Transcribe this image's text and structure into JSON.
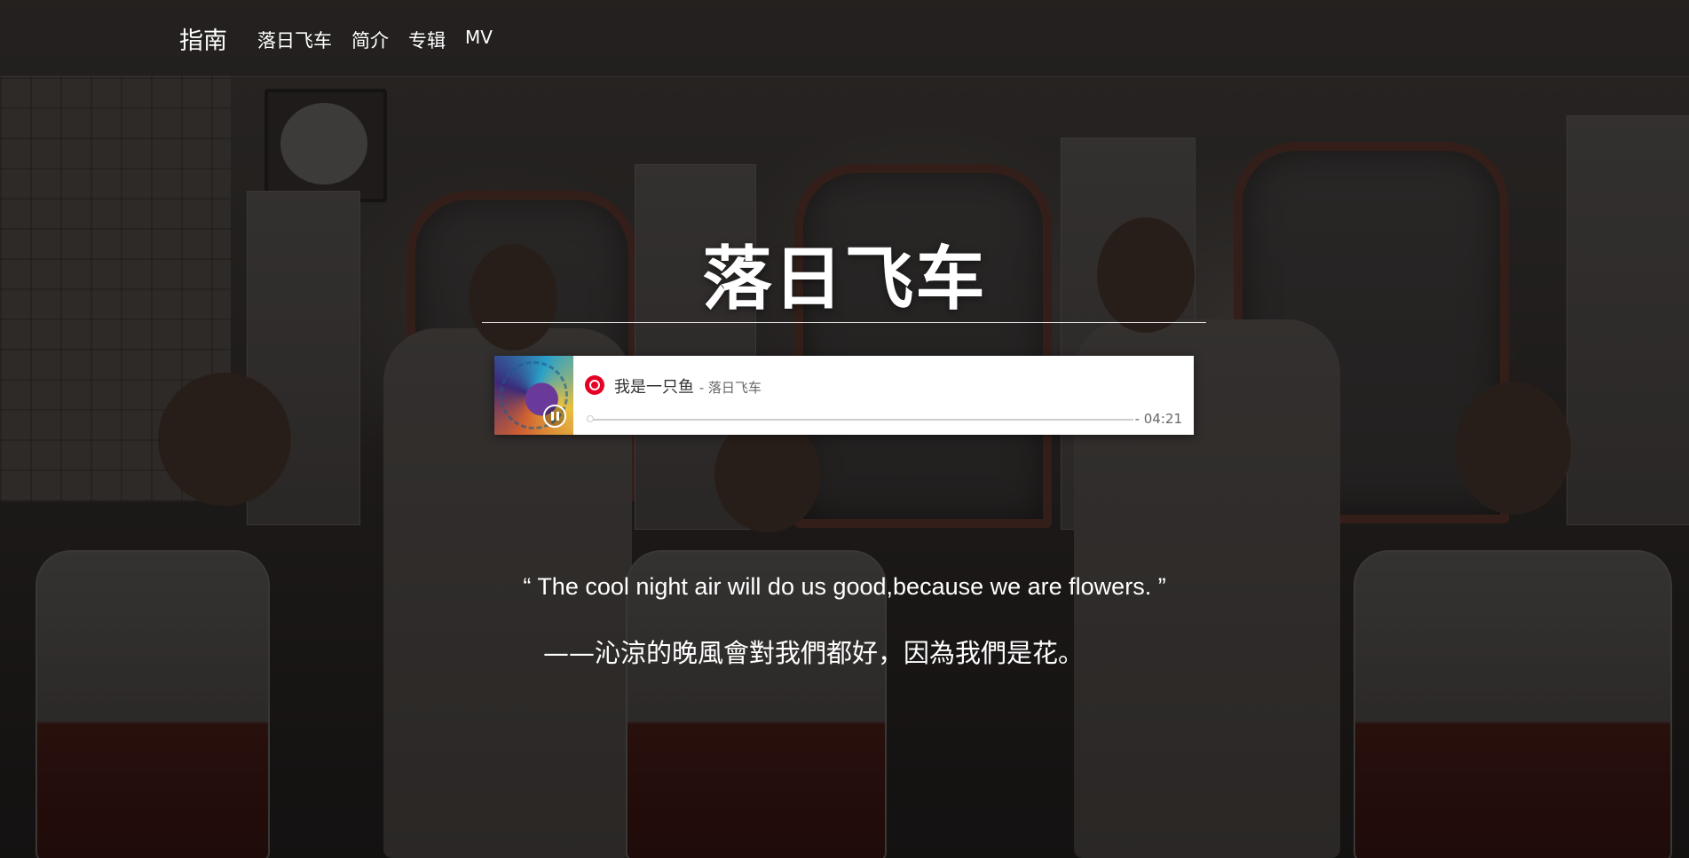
{
  "nav": {
    "brand": "指南",
    "links": [
      "落日飞车",
      "简介",
      "专辑",
      "MV"
    ]
  },
  "hero": {
    "title": "落日飞车"
  },
  "player": {
    "song_title": "我是一只鱼",
    "artist": "- 落日飞车",
    "time": "- 04:21",
    "progress": 0,
    "state": "playing",
    "service_icon": "netease-music-icon",
    "accent_color": "#e60026"
  },
  "quote": {
    "english": "“ The cool night air will do us good,because we are flowers. ”",
    "chinese": "——沁涼的晚風會對我們都好，因為我們是花。"
  }
}
